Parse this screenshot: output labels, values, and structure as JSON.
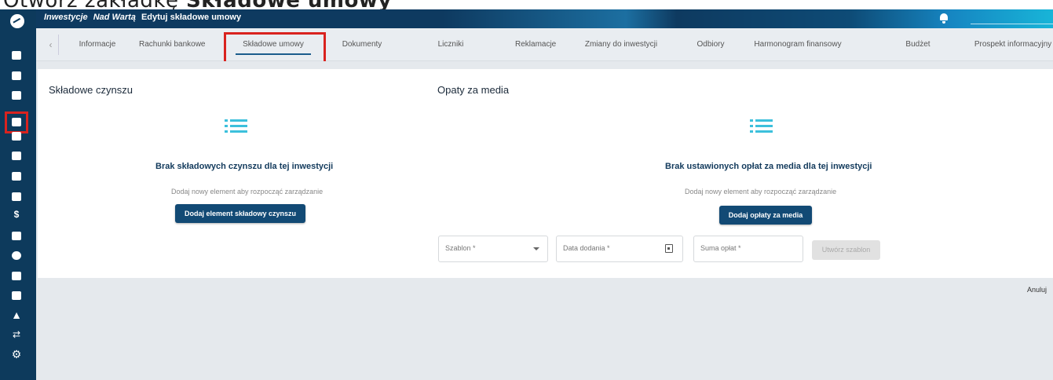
{
  "caption": {
    "prefix": "Otwórz zakładkę",
    "bold": "Składowe umowy"
  },
  "breadcrumb": {
    "section": "Inwestycje",
    "project": "Nad Wartą",
    "page": "Edytuj składowe umowy"
  },
  "tabs": [
    {
      "label": "Informacje"
    },
    {
      "label": "Rachunki bankowe"
    },
    {
      "label": "Składowe umowy"
    },
    {
      "label": "Dokumenty"
    },
    {
      "label": "Liczniki"
    },
    {
      "label": "Reklamacje"
    },
    {
      "label": "Zmiany do inwestycji"
    },
    {
      "label": "Odbiory"
    },
    {
      "label": "Harmonogram finansowy"
    },
    {
      "label": "Budżet"
    },
    {
      "label": "Prospekt informacyjny"
    }
  ],
  "rent": {
    "title": "Składowe czynszu",
    "empty_title": "Brak składowych czynszu dla tej inwestycji",
    "empty_sub": "Dodaj nowy element aby rozpocząć zarządzanie",
    "button": "Dodaj element składowy czynszu"
  },
  "media": {
    "title": "Opaty za media",
    "empty_title": "Brak ustawionych opłat za media dla tej inwestycji",
    "empty_sub": "Dodaj nowy element aby rozpocząć zarządzanie",
    "button": "Dodaj opłaty za media",
    "template_placeholder": "Szablon *",
    "date_placeholder": "Data dodania *",
    "sum_placeholder": "Suma opłat *",
    "create_button": "Utwórz szablon"
  },
  "footer": {
    "cancel": "Anuluj"
  },
  "colors": {
    "sidebar": "#0d3a5c",
    "primary": "#124a75",
    "accent": "#3cc0dc",
    "highlight": "#d9231f"
  }
}
